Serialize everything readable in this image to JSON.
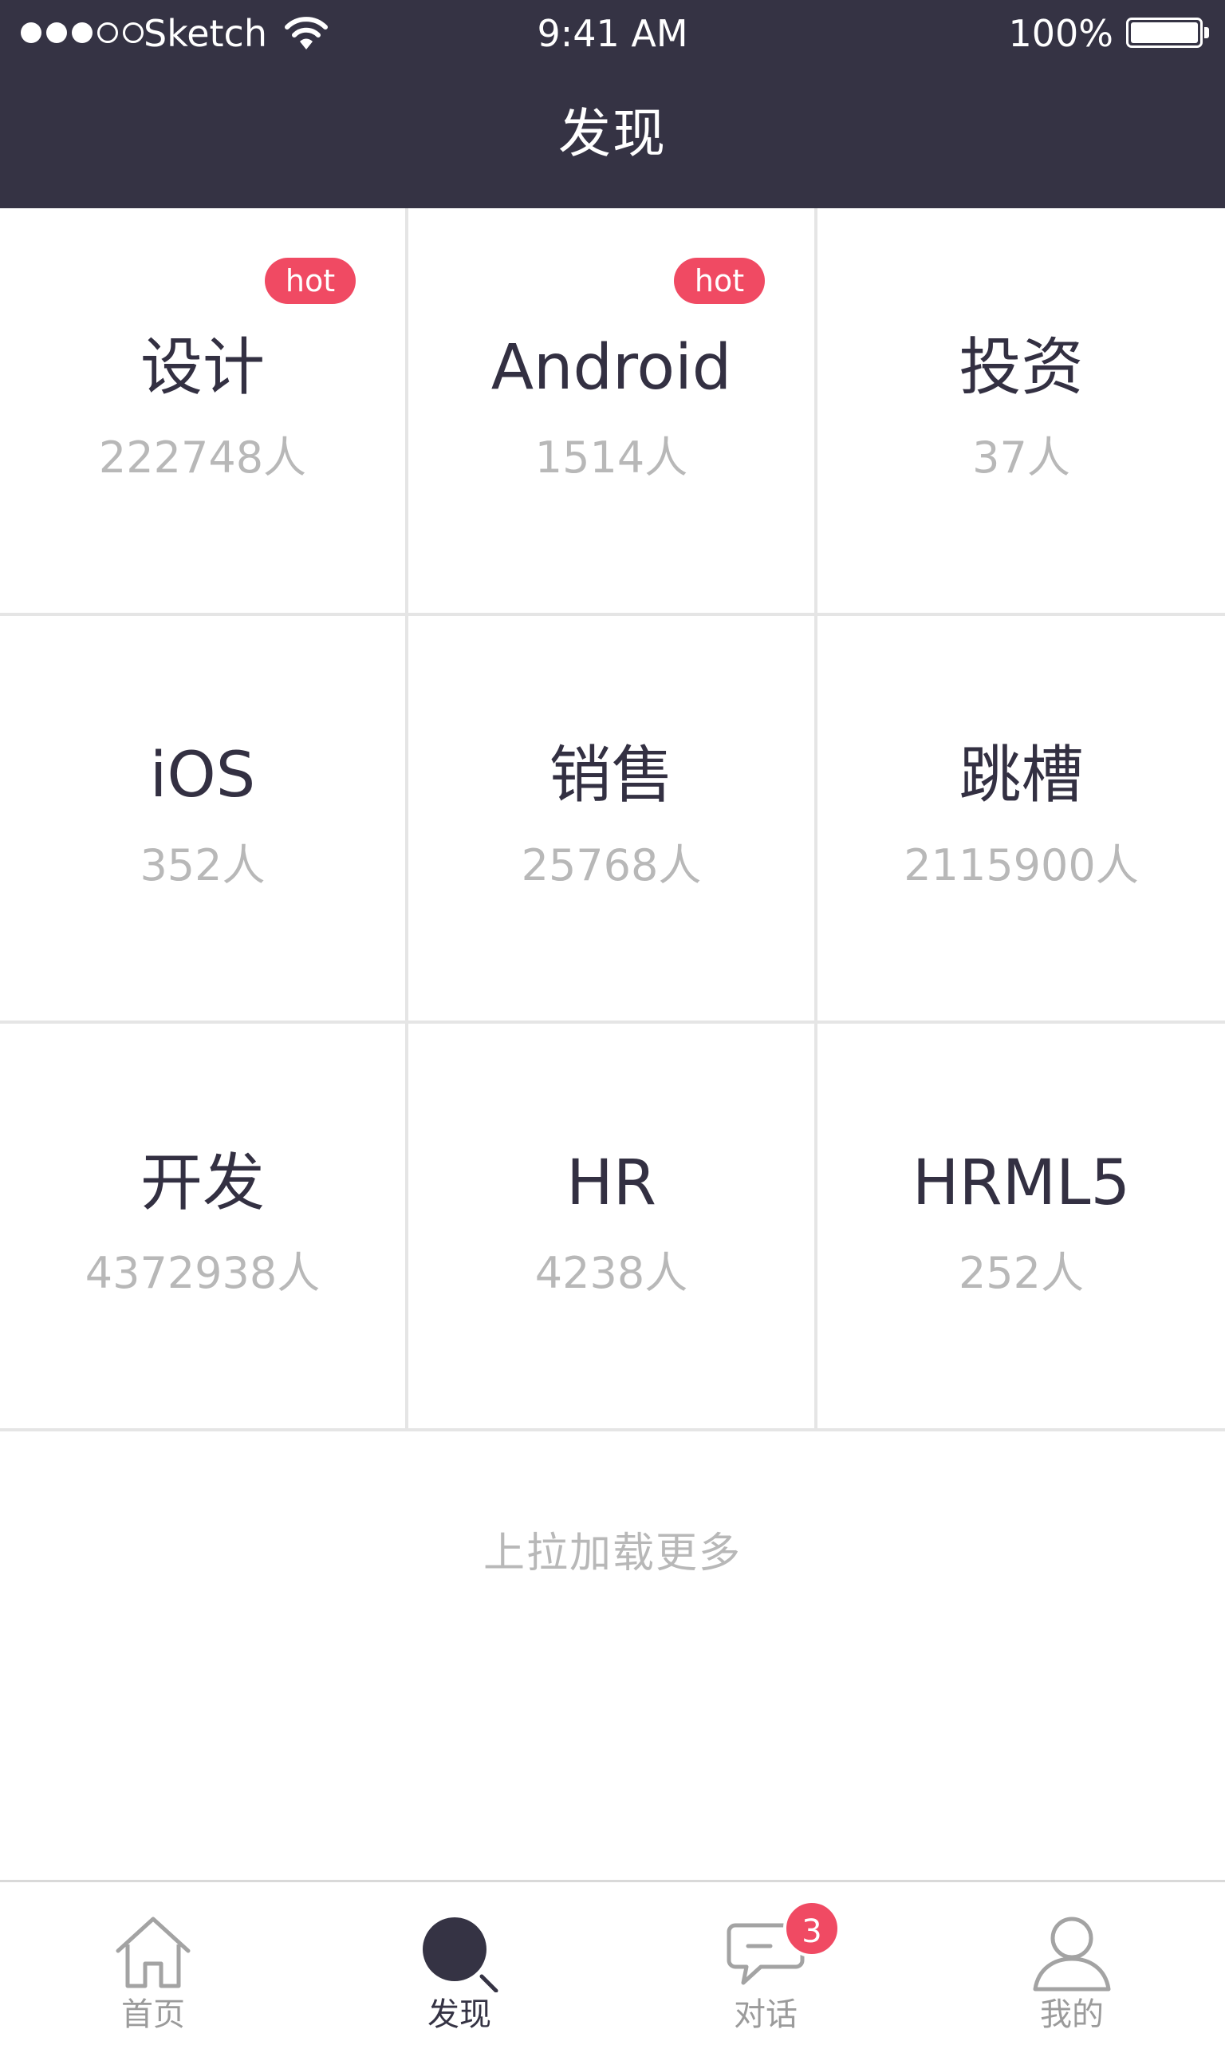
{
  "status_bar": {
    "carrier": "Sketch",
    "time": "9:41 AM",
    "battery": "100%"
  },
  "header": {
    "title": "发现"
  },
  "categories": [
    {
      "name": "设计",
      "count": "222748人",
      "badge": "hot"
    },
    {
      "name": "Android",
      "count": "1514人",
      "badge": "hot"
    },
    {
      "name": "投资",
      "count": "37人",
      "badge": ""
    },
    {
      "name": "iOS",
      "count": "352人",
      "badge": ""
    },
    {
      "name": "销售",
      "count": "25768人",
      "badge": ""
    },
    {
      "name": "跳槽",
      "count": "2115900人",
      "badge": ""
    },
    {
      "name": "开发",
      "count": "4372938人",
      "badge": ""
    },
    {
      "name": "HR",
      "count": "4238人",
      "badge": ""
    },
    {
      "name": "HRML5",
      "count": "252人",
      "badge": ""
    }
  ],
  "load_more": "上拉加载更多",
  "tabbar": {
    "items": [
      {
        "label": "首页",
        "icon": "home-icon"
      },
      {
        "label": "发现",
        "icon": "discover-icon",
        "active": true
      },
      {
        "label": "对话",
        "icon": "chat-icon",
        "badge": "3"
      },
      {
        "label": "我的",
        "icon": "profile-icon"
      }
    ]
  },
  "colors": {
    "header_bg": "#353344",
    "hot_badge": "#f04a63",
    "count_text": "#b8b8b8"
  }
}
